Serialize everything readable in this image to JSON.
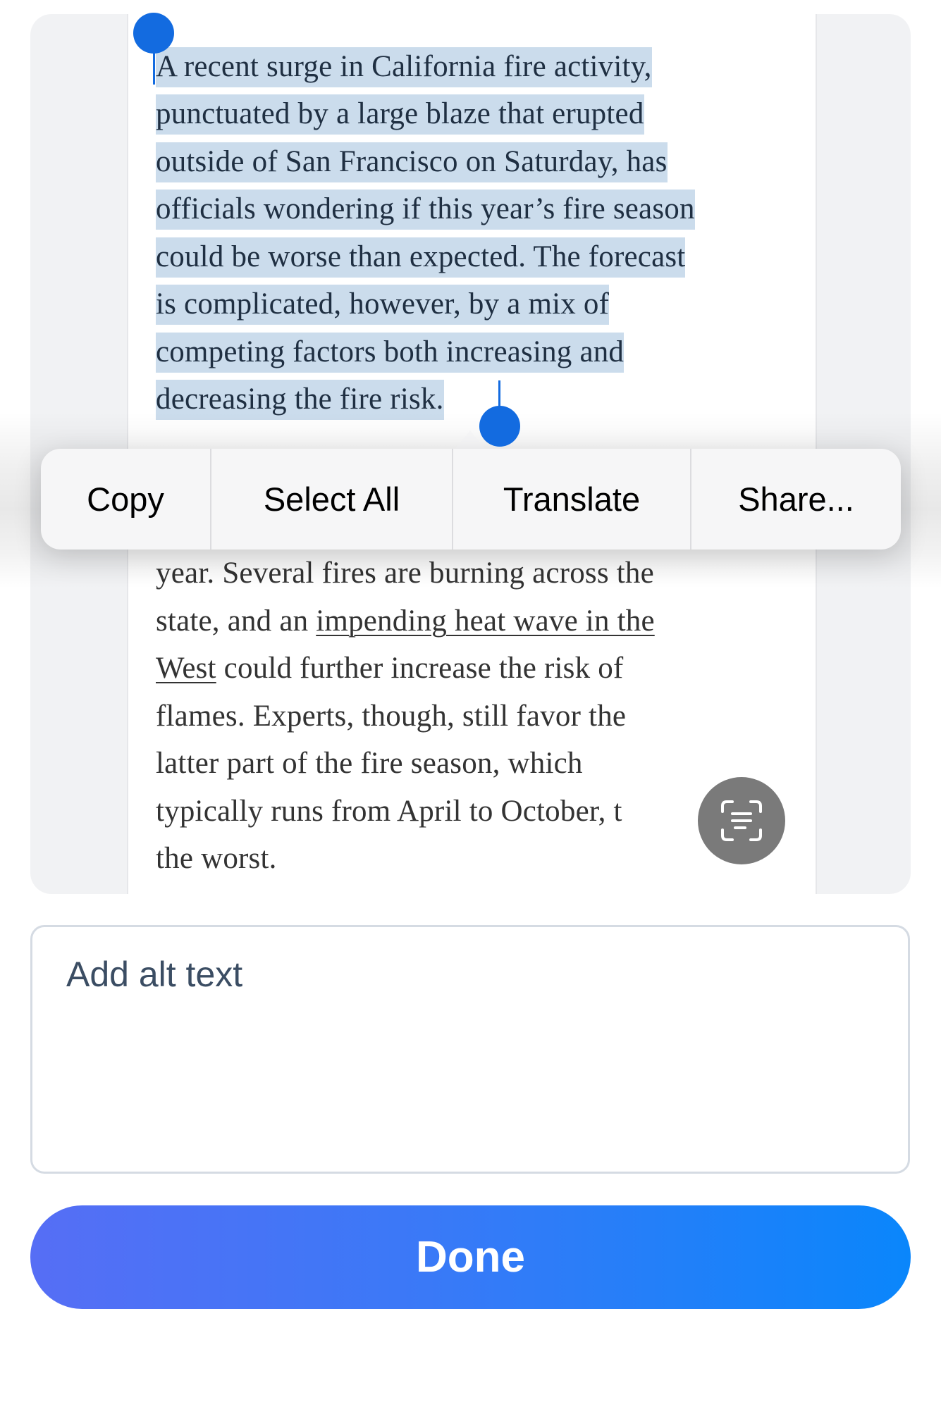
{
  "image_preview": {
    "selected_lines": [
      "A recent surge in California fire activity,",
      "punctuated by a large blaze that erupted",
      "outside of San Francisco on Saturday, has",
      "officials wondering if this year’s fire season",
      "could be worse than expected. The forecast",
      "is complicated, however, by a mix of",
      "competing factors both increasing and",
      "decreasing the fire risk."
    ],
    "body_lines": [
      {
        "before": "year. Several fires are burning across the",
        "link": "",
        "after": ""
      },
      {
        "before": "state, and an ",
        "link": "impending heat wave in the",
        "after": ""
      },
      {
        "before": "",
        "link": "West",
        "after": " could further increase the risk of"
      },
      {
        "before": "flames. Experts, though, still favor the",
        "link": "",
        "after": ""
      },
      {
        "before": "latter part of the fire season, which",
        "link": "",
        "after": ""
      },
      {
        "before": "typically runs from April to October, t",
        "link": "",
        "after": ""
      },
      {
        "before": "the worst.",
        "link": "",
        "after": ""
      }
    ],
    "live_text_icon": "live-text-scan-icon"
  },
  "edit_menu": {
    "items": [
      {
        "label": "Copy"
      },
      {
        "label": "Select All"
      },
      {
        "label": "Translate"
      },
      {
        "label": "Share..."
      }
    ]
  },
  "alt_text": {
    "value": "",
    "placeholder": "Add alt text"
  },
  "done_button": {
    "label": "Done"
  },
  "colors": {
    "selection_highlight": "#cbdcec",
    "selection_handle": "#136be0",
    "done_gradient_start": "#566ef5",
    "done_gradient_end": "#0a86fb"
  }
}
